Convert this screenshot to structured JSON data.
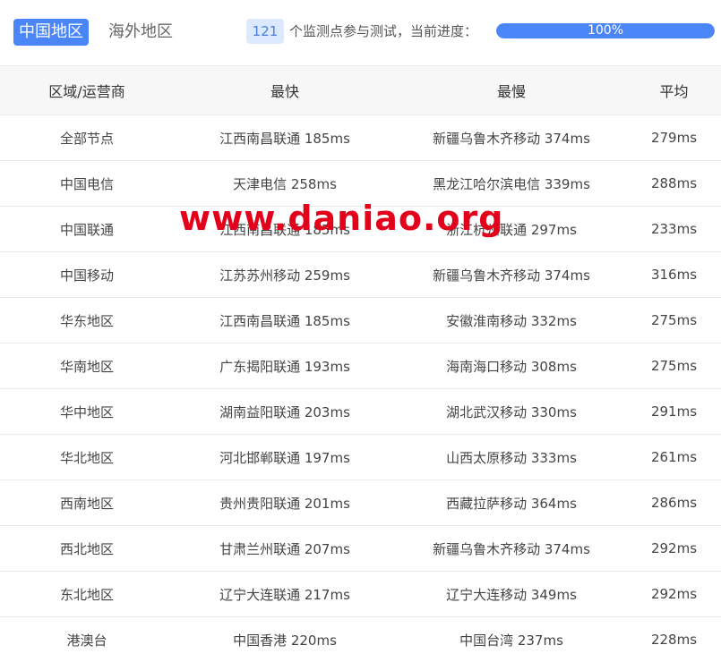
{
  "tabs": [
    {
      "label": "中国地区",
      "active": true
    },
    {
      "label": "海外地区",
      "active": false
    }
  ],
  "progress": {
    "count": "121",
    "text": "个监测点参与测试，当前进度：",
    "percent": 100,
    "label": "100%"
  },
  "table": {
    "headers": [
      "区域/运营商",
      "最快",
      "最慢",
      "平均"
    ],
    "rows": [
      [
        "全部节点",
        "江西南昌联通 185ms",
        "新疆乌鲁木齐移动 374ms",
        "279ms"
      ],
      [
        "中国电信",
        "天津电信 258ms",
        "黑龙江哈尔滨电信 339ms",
        "288ms"
      ],
      [
        "中国联通",
        "江西南昌联通 185ms",
        "浙江杭州联通 297ms",
        "233ms"
      ],
      [
        "中国移动",
        "江苏苏州移动 259ms",
        "新疆乌鲁木齐移动 374ms",
        "316ms"
      ],
      [
        "华东地区",
        "江西南昌联通 185ms",
        "安徽淮南移动 332ms",
        "275ms"
      ],
      [
        "华南地区",
        "广东揭阳联通 193ms",
        "海南海口移动 308ms",
        "275ms"
      ],
      [
        "华中地区",
        "湖南益阳联通 203ms",
        "湖北武汉移动 330ms",
        "291ms"
      ],
      [
        "华北地区",
        "河北邯郸联通 197ms",
        "山西太原移动 333ms",
        "261ms"
      ],
      [
        "西南地区",
        "贵州贵阳联通 201ms",
        "西藏拉萨移动 364ms",
        "286ms"
      ],
      [
        "西北地区",
        "甘肃兰州联通 207ms",
        "新疆乌鲁木齐移动 374ms",
        "292ms"
      ],
      [
        "东北地区",
        "辽宁大连联通 217ms",
        "辽宁大连移动 349ms",
        "292ms"
      ],
      [
        "港澳台",
        "中国香港 220ms",
        "中国台湾 237ms",
        "228ms"
      ]
    ]
  },
  "watermark": "www.daniao.org",
  "colors": {
    "accent": "#4a86f7",
    "badge_bg": "#dbe8fd",
    "watermark": "#e3001b"
  }
}
